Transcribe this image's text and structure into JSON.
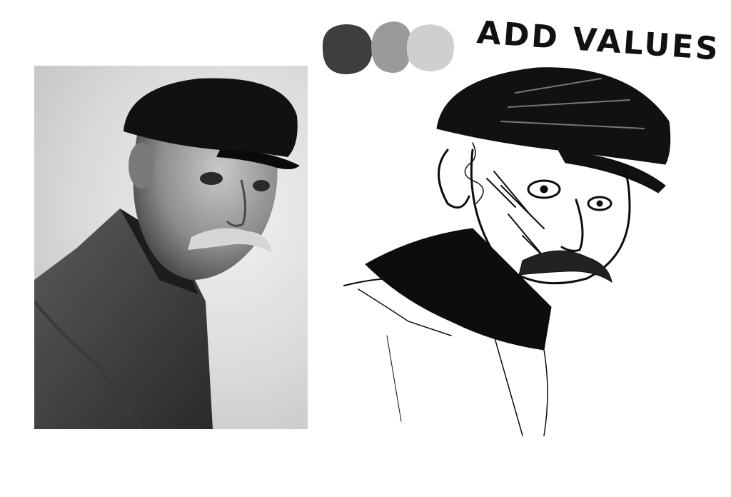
{
  "heading": "ADD VALUES",
  "palette": {
    "dark": "#3e3e3e",
    "mid": "#9a9a9a",
    "light": "#cfcfcf"
  },
  "reference_photo": {
    "description_icon": "old-man-portrait",
    "tone": "grayscale"
  },
  "sketch": {
    "icon": "value-sketch",
    "ink": "#0d0d0d"
  }
}
